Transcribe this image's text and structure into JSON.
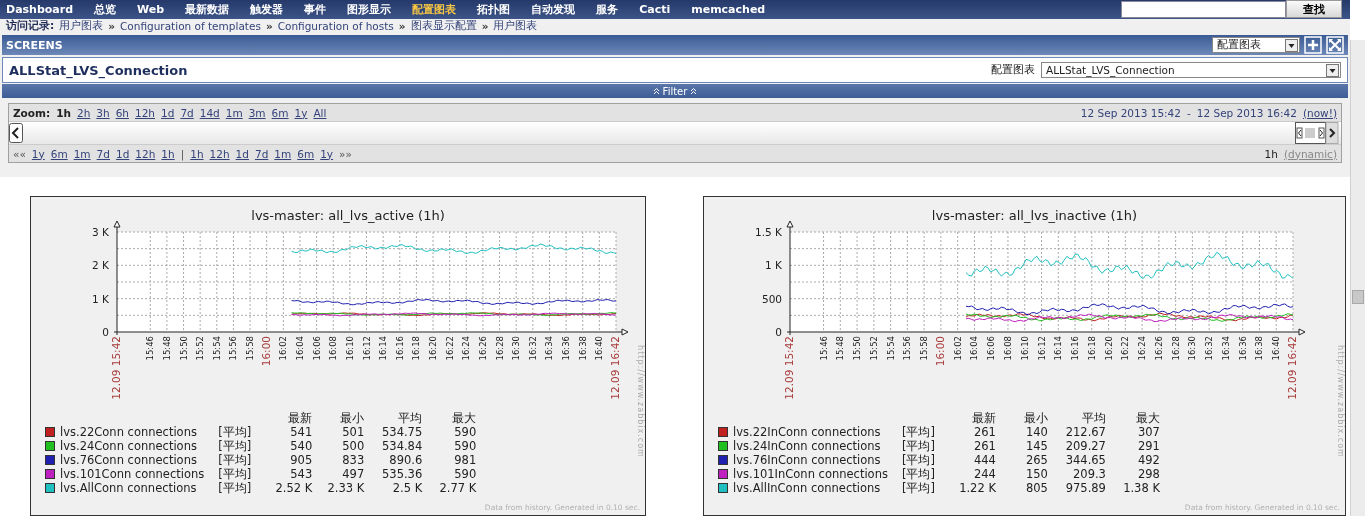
{
  "nav": {
    "items": [
      {
        "label": "Dashboard",
        "selected": false
      },
      {
        "label": "总览",
        "selected": false
      },
      {
        "label": "Web",
        "selected": false
      },
      {
        "label": "最新数据",
        "selected": false
      },
      {
        "label": "触发器",
        "selected": false
      },
      {
        "label": "事件",
        "selected": false
      },
      {
        "label": "图形显示",
        "selected": false
      },
      {
        "label": "配置图表",
        "selected": true
      },
      {
        "label": "拓扑图",
        "selected": false
      },
      {
        "label": "自动发现",
        "selected": false
      },
      {
        "label": "服务",
        "selected": false
      },
      {
        "label": "Cacti",
        "selected": false
      },
      {
        "label": "memcached",
        "selected": false
      }
    ],
    "search_button": "查找"
  },
  "breadcrumb": {
    "label": "访问记录:",
    "separator": "»",
    "items": [
      "用户图表",
      "Configuration of templates",
      "Configuration of hosts",
      "图表显示配置",
      "用户图表"
    ]
  },
  "screens_bar": {
    "title": "SCREENS",
    "dropdown": "配置图表"
  },
  "screen": {
    "title": "ALLStat_LVS_Connection",
    "select_label": "配置图表",
    "select_value": "ALLStat_LVS_Connection"
  },
  "filter": {
    "label": "Filter"
  },
  "zoom": {
    "label": "Zoom:",
    "options": [
      {
        "label": "1h",
        "selected": true
      },
      {
        "label": "2h",
        "selected": false
      },
      {
        "label": "3h",
        "selected": false
      },
      {
        "label": "6h",
        "selected": false
      },
      {
        "label": "12h",
        "selected": false
      },
      {
        "label": "1d",
        "selected": false
      },
      {
        "label": "7d",
        "selected": false
      },
      {
        "label": "14d",
        "selected": false
      },
      {
        "label": "1m",
        "selected": false
      },
      {
        "label": "3m",
        "selected": false
      },
      {
        "label": "6m",
        "selected": false
      },
      {
        "label": "1y",
        "selected": false
      },
      {
        "label": "All",
        "selected": false
      }
    ],
    "from": "12 Sep 2013 15:42",
    "dash": "-",
    "to": "12 Sep 2013 16:42",
    "now": "(now!)",
    "back_mark": "««",
    "back": [
      "1y",
      "6m",
      "1m",
      "7d",
      "1d",
      "12h",
      "1h"
    ],
    "divider": "|",
    "forward": [
      "1h",
      "12h",
      "1d",
      "7d",
      "1m",
      "6m",
      "1y"
    ],
    "forward_mark": "»»",
    "period": "1h",
    "mode": "(dynamic)"
  },
  "graphs": [
    {
      "title": "lvs-master: all_lvs_active (1h)",
      "y_ticks": [
        "3 K",
        "2 K",
        "1 K",
        "0"
      ],
      "x_ticks": [
        {
          "label": "12.09 15:42",
          "kind": "edge"
        },
        {
          "label": "15:46",
          "kind": "minor"
        },
        {
          "label": "15:48",
          "kind": "minor"
        },
        {
          "label": "15:50",
          "kind": "minor"
        },
        {
          "label": "15:52",
          "kind": "minor"
        },
        {
          "label": "15:54",
          "kind": "minor"
        },
        {
          "label": "15:56",
          "kind": "minor"
        },
        {
          "label": "15:58",
          "kind": "minor"
        },
        {
          "label": "16:00",
          "kind": "hour"
        },
        {
          "label": "16:02",
          "kind": "minor"
        },
        {
          "label": "16:04",
          "kind": "minor"
        },
        {
          "label": "16:06",
          "kind": "minor"
        },
        {
          "label": "16:08",
          "kind": "minor"
        },
        {
          "label": "16:10",
          "kind": "minor"
        },
        {
          "label": "16:12",
          "kind": "minor"
        },
        {
          "label": "16:14",
          "kind": "minor"
        },
        {
          "label": "16:16",
          "kind": "minor"
        },
        {
          "label": "16:18",
          "kind": "minor"
        },
        {
          "label": "16:20",
          "kind": "minor"
        },
        {
          "label": "16:22",
          "kind": "minor"
        },
        {
          "label": "16:24",
          "kind": "minor"
        },
        {
          "label": "16:26",
          "kind": "minor"
        },
        {
          "label": "16:28",
          "kind": "minor"
        },
        {
          "label": "16:30",
          "kind": "minor"
        },
        {
          "label": "16:32",
          "kind": "minor"
        },
        {
          "label": "16:34",
          "kind": "minor"
        },
        {
          "label": "16:36",
          "kind": "minor"
        },
        {
          "label": "16:38",
          "kind": "minor"
        },
        {
          "label": "16:40",
          "kind": "minor"
        },
        {
          "label": "12.09 16:42",
          "kind": "edge"
        }
      ],
      "site": "http://www.zabbix.com",
      "headers": [
        "最新",
        "最小",
        "平均",
        "最大"
      ],
      "legend": [
        {
          "name": "lvs.22Conn connections",
          "color": "#c02020",
          "func": "[平均]",
          "values": [
            "541",
            "501",
            "534.75",
            "590"
          ]
        },
        {
          "name": "lvs.24Conn connections",
          "color": "#20c020",
          "func": "[平均]",
          "values": [
            "540",
            "500",
            "534.84",
            "590"
          ]
        },
        {
          "name": "lvs.76Conn connections",
          "color": "#2020b0",
          "func": "[平均]",
          "values": [
            "905",
            "833",
            "890.6",
            "981"
          ]
        },
        {
          "name": "lvs.101Conn connections",
          "color": "#c020c0",
          "func": "[平均]",
          "values": [
            "543",
            "497",
            "535.36",
            "590"
          ]
        },
        {
          "name": "lvs.AllConn connections",
          "color": "#20c0c0",
          "func": "[平均]",
          "values": [
            "2.52 K",
            "2.33 K",
            "2.5 K",
            "2.77 K"
          ]
        }
      ],
      "footer": "Data from history. Generated in 0.10 sec."
    },
    {
      "title": "lvs-master: all_lvs_inactive (1h)",
      "y_ticks": [
        "1.5 K",
        "1 K",
        "500",
        "0"
      ],
      "x_ticks": [
        {
          "label": "12.09 15:42",
          "kind": "edge"
        },
        {
          "label": "15:46",
          "kind": "minor"
        },
        {
          "label": "15:48",
          "kind": "minor"
        },
        {
          "label": "15:50",
          "kind": "minor"
        },
        {
          "label": "15:52",
          "kind": "minor"
        },
        {
          "label": "15:54",
          "kind": "minor"
        },
        {
          "label": "15:56",
          "kind": "minor"
        },
        {
          "label": "15:58",
          "kind": "minor"
        },
        {
          "label": "16:00",
          "kind": "hour"
        },
        {
          "label": "16:02",
          "kind": "minor"
        },
        {
          "label": "16:04",
          "kind": "minor"
        },
        {
          "label": "16:06",
          "kind": "minor"
        },
        {
          "label": "16:08",
          "kind": "minor"
        },
        {
          "label": "16:10",
          "kind": "minor"
        },
        {
          "label": "16:12",
          "kind": "minor"
        },
        {
          "label": "16:14",
          "kind": "minor"
        },
        {
          "label": "16:16",
          "kind": "minor"
        },
        {
          "label": "16:18",
          "kind": "minor"
        },
        {
          "label": "16:20",
          "kind": "minor"
        },
        {
          "label": "16:22",
          "kind": "minor"
        },
        {
          "label": "16:24",
          "kind": "minor"
        },
        {
          "label": "16:26",
          "kind": "minor"
        },
        {
          "label": "16:28",
          "kind": "minor"
        },
        {
          "label": "16:30",
          "kind": "minor"
        },
        {
          "label": "16:32",
          "kind": "minor"
        },
        {
          "label": "16:34",
          "kind": "minor"
        },
        {
          "label": "16:36",
          "kind": "minor"
        },
        {
          "label": "16:38",
          "kind": "minor"
        },
        {
          "label": "16:40",
          "kind": "minor"
        },
        {
          "label": "12.09 16:42",
          "kind": "edge"
        }
      ],
      "site": "http://www.zabbix.com",
      "headers": [
        "最新",
        "最小",
        "平均",
        "最大"
      ],
      "legend": [
        {
          "name": "lvs.22InConn connections",
          "color": "#c02020",
          "func": "[平均]",
          "values": [
            "261",
            "140",
            "212.67",
            "307"
          ]
        },
        {
          "name": "lvs.24InConn connections",
          "color": "#20c020",
          "func": "[平均]",
          "values": [
            "261",
            "145",
            "209.27",
            "291"
          ]
        },
        {
          "name": "lvs.76InConn connections",
          "color": "#2020b0",
          "func": "[平均]",
          "values": [
            "444",
            "265",
            "344.65",
            "492"
          ]
        },
        {
          "name": "lvs.101InConn connections",
          "color": "#c020c0",
          "func": "[平均]",
          "values": [
            "244",
            "150",
            "209.3",
            "298"
          ]
        },
        {
          "name": "lvs.AllInConn connections",
          "color": "#20c0c0",
          "func": "[平均]",
          "values": [
            "1.22 K",
            "805",
            "975.89",
            "1.38 K"
          ]
        }
      ],
      "footer": "Data from history. Generated in 0.10 sec."
    }
  ]
}
